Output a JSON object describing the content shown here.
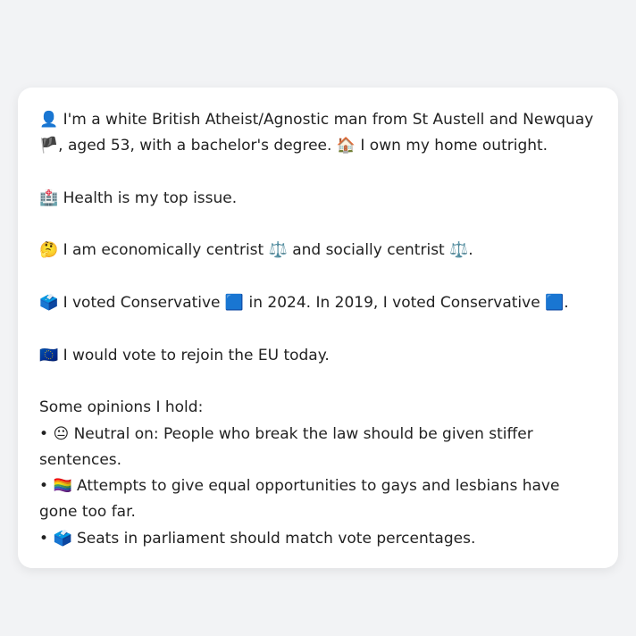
{
  "profile": {
    "intro_icon": "👤",
    "intro_text": "I'm a white British Atheist/Agnostic man from St Austell and Newquay",
    "england_flag": "🏴",
    "intro_text2": ", aged 53, with a bachelor's degree.",
    "home_icon": "🏠",
    "home_text": "I own my home outright."
  },
  "health": {
    "icon": "🏥",
    "text": "Health is my top issue."
  },
  "economics": {
    "icon": "🤔",
    "text1": "I am economically centrist",
    "scale1": "⚖️",
    "text2": "and socially centrist",
    "scale2": "⚖️",
    "text3": "."
  },
  "voting": {
    "icon": "🗳️",
    "text1": "I voted Conservative",
    "party_square1": "🟦",
    "text2": "in 2024. In 2019, I voted Conservative",
    "party_square2": "🟦",
    "text3": "."
  },
  "eu": {
    "icon": "🇪🇺",
    "text": "I would vote to rejoin the EU today."
  },
  "opinions": {
    "heading": "Some opinions I hold:",
    "items": [
      {
        "bullet": "•",
        "icon": "😐",
        "text": "Neutral on: People who break the law should be given stiffer sentences."
      },
      {
        "bullet": "•",
        "icon": "🏳️‍🌈",
        "text": "Attempts to give equal opportunities to gays and lesbians have gone too far."
      },
      {
        "bullet": "•",
        "icon": "🗳️",
        "text": "Seats in parliament should match vote percentages."
      }
    ]
  }
}
